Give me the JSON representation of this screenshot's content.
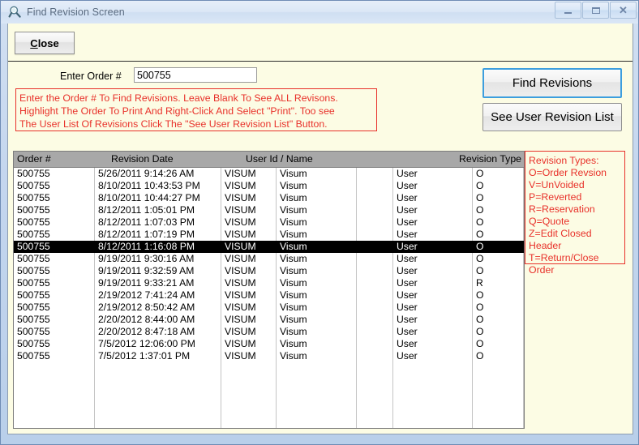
{
  "window": {
    "title": "Find Revision Screen",
    "icon": "magnifier-icon",
    "minimize_label": "",
    "maximize_label": "",
    "close_label": "✕"
  },
  "toolbar": {
    "close_button_accel": "C",
    "close_button_rest": "lose"
  },
  "form": {
    "order_label": "Enter Order #",
    "order_value": "500755",
    "order_placeholder": ""
  },
  "instructions": {
    "line1": "Enter the Order # To Find Revisions. Leave Blank To See ALL Revisons.",
    "line2": "Highlight The Order To Print And Right-Click And Select \"Print\". Too see",
    "line3": "The User List Of Revisions Click The \"See User Revision List\" Button."
  },
  "actions": {
    "find_revisions_label": "Find Revisions",
    "see_user_revision_list_label": "See User Revision List"
  },
  "legend": {
    "title": "Revision Types:",
    "entries": [
      "O=Order Revsion",
      "V=UnVoided",
      "P=Reverted",
      "R=Reservation",
      "Q=Quote",
      "Z=Edit Closed Header",
      "T=Return/Close Order"
    ]
  },
  "grid": {
    "headers": [
      "Order #",
      "Revision Date",
      "User Id / Name",
      "Revision Type"
    ],
    "selected_row_index": 6,
    "rows": [
      {
        "order": "500755",
        "date": "5/26/2011 9:14:26 AM",
        "user_id": "VISUM",
        "name": "Visum",
        "blank": "",
        "user": "User",
        "type": "O"
      },
      {
        "order": "500755",
        "date": "8/10/2011 10:43:53 PM",
        "user_id": "VISUM",
        "name": "Visum",
        "blank": "",
        "user": "User",
        "type": "O"
      },
      {
        "order": "500755",
        "date": "8/10/2011 10:44:27 PM",
        "user_id": "VISUM",
        "name": "Visum",
        "blank": "",
        "user": "User",
        "type": "O"
      },
      {
        "order": "500755",
        "date": "8/12/2011 1:05:01 PM",
        "user_id": "VISUM",
        "name": "Visum",
        "blank": "",
        "user": "User",
        "type": "O"
      },
      {
        "order": "500755",
        "date": "8/12/2011 1:07:03 PM",
        "user_id": "VISUM",
        "name": "Visum",
        "blank": "",
        "user": "User",
        "type": "O"
      },
      {
        "order": "500755",
        "date": "8/12/2011 1:07:19 PM",
        "user_id": "VISUM",
        "name": "Visum",
        "blank": "",
        "user": "User",
        "type": "O"
      },
      {
        "order": "500755",
        "date": "8/12/2011 1:16:08 PM",
        "user_id": "VISUM",
        "name": "Visum",
        "blank": "",
        "user": "User",
        "type": "O"
      },
      {
        "order": "500755",
        "date": "9/19/2011 9:30:16 AM",
        "user_id": "VISUM",
        "name": "Visum",
        "blank": "",
        "user": "User",
        "type": "O"
      },
      {
        "order": "500755",
        "date": "9/19/2011 9:32:59 AM",
        "user_id": "VISUM",
        "name": "Visum",
        "blank": "",
        "user": "User",
        "type": "O"
      },
      {
        "order": "500755",
        "date": "9/19/2011 9:33:21 AM",
        "user_id": "VISUM",
        "name": "Visum",
        "blank": "",
        "user": "User",
        "type": "R"
      },
      {
        "order": "500755",
        "date": "2/19/2012 7:41:24 AM",
        "user_id": "VISUM",
        "name": "Visum",
        "blank": "",
        "user": "User",
        "type": "O"
      },
      {
        "order": "500755",
        "date": "2/19/2012 8:50:42 AM",
        "user_id": "VISUM",
        "name": "Visum",
        "blank": "",
        "user": "User",
        "type": "O"
      },
      {
        "order": "500755",
        "date": "2/20/2012 8:44:00 AM",
        "user_id": "VISUM",
        "name": "Visum",
        "blank": "",
        "user": "User",
        "type": "O"
      },
      {
        "order": "500755",
        "date": "2/20/2012 8:47:18 AM",
        "user_id": "VISUM",
        "name": "Visum",
        "blank": "",
        "user": "User",
        "type": "O"
      },
      {
        "order": "500755",
        "date": "7/5/2012 12:06:00 PM",
        "user_id": "VISUM",
        "name": "Visum",
        "blank": "",
        "user": "User",
        "type": "O"
      },
      {
        "order": "500755",
        "date": "7/5/2012 1:37:01 PM",
        "user_id": "VISUM",
        "name": "Visum",
        "blank": "",
        "user": "User",
        "type": "O"
      }
    ]
  },
  "colors": {
    "frame": "#b9cfea",
    "client_bg": "#fcfce4",
    "accent_red": "#e8312a",
    "focus_blue": "#3c9ede",
    "header_gray": "#a8a8a8",
    "selection": "#000000"
  }
}
